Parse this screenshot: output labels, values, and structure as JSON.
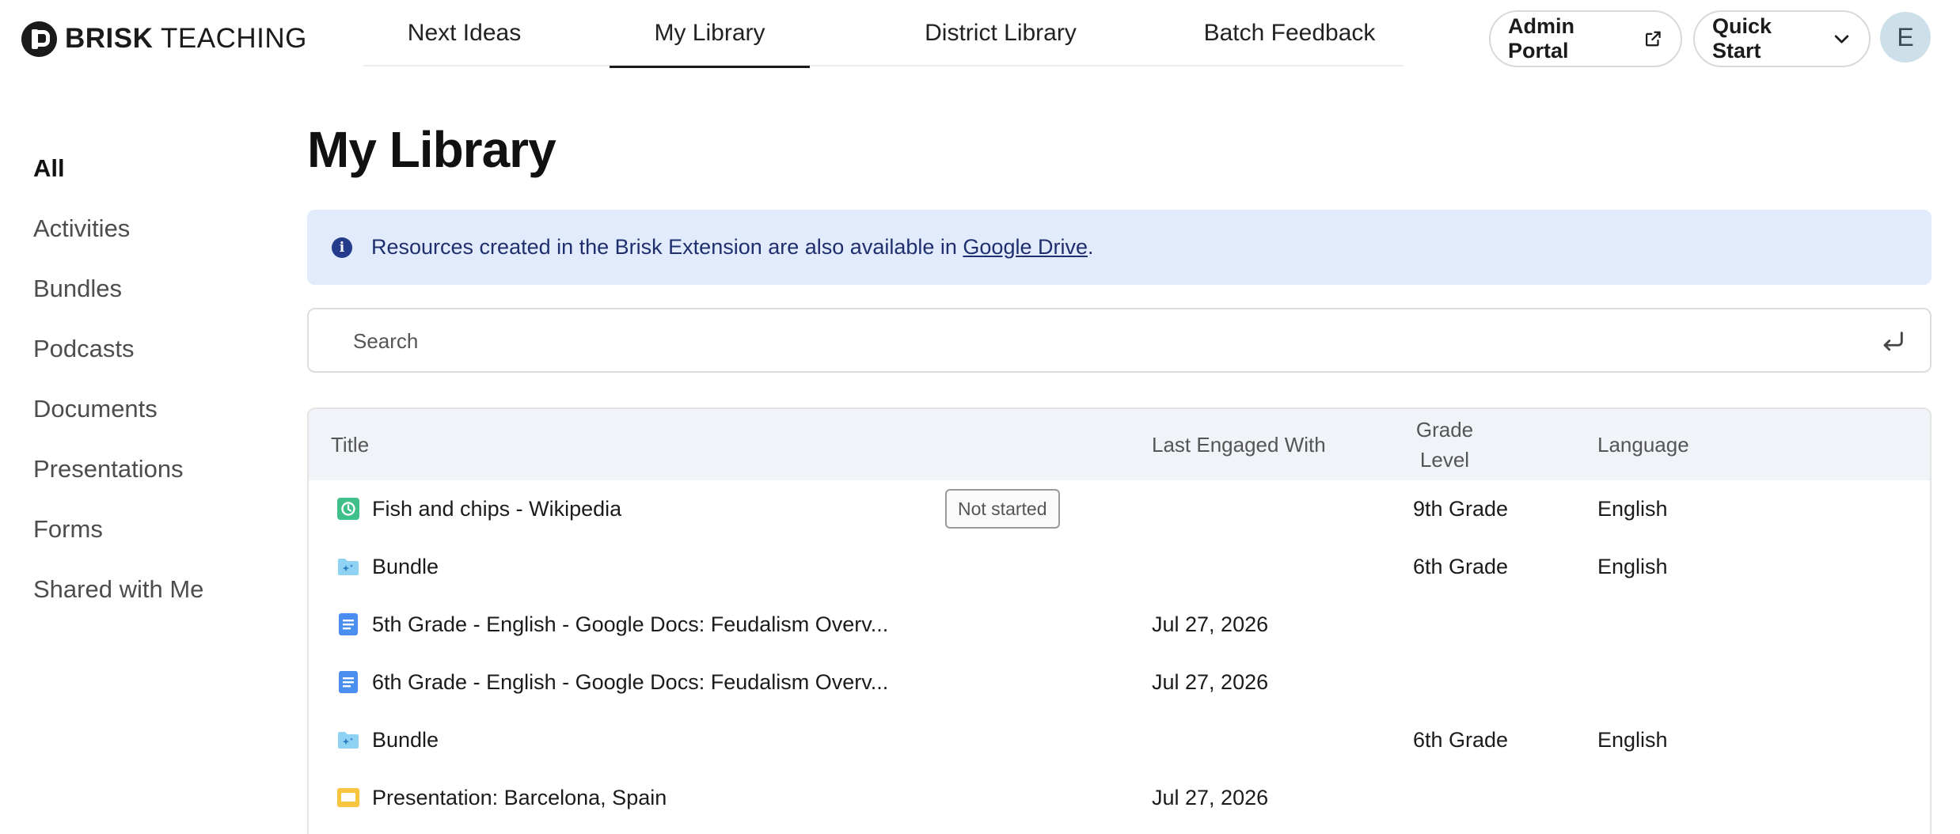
{
  "app": {
    "brand_bold": "BRISK",
    "brand_rest": " TEACHING"
  },
  "nav": {
    "tabs": [
      {
        "label": "Next Ideas"
      },
      {
        "label": "My Library"
      },
      {
        "label": "District Library"
      },
      {
        "label": "Batch Feedback"
      }
    ],
    "active_tab": "My Library"
  },
  "header": {
    "admin_portal_label": "Admin Portal",
    "quick_start_label": "Quick Start",
    "avatar_initial": "E"
  },
  "sidebar": {
    "items": [
      {
        "label": "All"
      },
      {
        "label": "Activities"
      },
      {
        "label": "Bundles"
      },
      {
        "label": "Podcasts"
      },
      {
        "label": "Documents"
      },
      {
        "label": "Presentations"
      },
      {
        "label": "Forms"
      },
      {
        "label": "Shared with Me"
      }
    ],
    "active_item": "All"
  },
  "main": {
    "title": "My Library",
    "banner": {
      "text_before": "Resources created in the Brisk Extension are also available in ",
      "link_text": "Google Drive",
      "text_after": "."
    },
    "search": {
      "placeholder": "Search",
      "value": ""
    },
    "table": {
      "columns": {
        "title": "Title",
        "last_engaged": "Last Engaged With",
        "grade_line1": "Grade",
        "grade_line2": "Level",
        "language": "Language"
      },
      "rows": [
        {
          "icon": "activity-icon",
          "title": "Fish and chips - Wikipedia",
          "status": "Not started",
          "last_engaged": "",
          "grade": "9th Grade",
          "language": "English"
        },
        {
          "icon": "bundle-folder-icon",
          "title": "Bundle",
          "status": "",
          "last_engaged": "",
          "grade": "6th Grade",
          "language": "English"
        },
        {
          "icon": "google-doc-icon",
          "title": "5th Grade - English - Google Docs: Feudalism Overv...",
          "status": "",
          "last_engaged": "Jul 27, 2026",
          "grade": "",
          "language": ""
        },
        {
          "icon": "google-doc-icon",
          "title": "6th Grade - English - Google Docs: Feudalism Overv...",
          "status": "",
          "last_engaged": "Jul 27, 2026",
          "grade": "",
          "language": ""
        },
        {
          "icon": "bundle-folder-icon",
          "title": "Bundle",
          "status": "",
          "last_engaged": "",
          "grade": "6th Grade",
          "language": "English"
        },
        {
          "icon": "google-slides-icon",
          "title": "Presentation: Barcelona, Spain",
          "status": "",
          "last_engaged": "Jul 27, 2026",
          "grade": "",
          "language": ""
        }
      ]
    }
  },
  "colors": {
    "banner_bg": "#e1ebfb",
    "banner_text": "#1f2f6e",
    "activity_green": "#3fbf8a",
    "bundle_blue": "#8fd3f4",
    "doc_blue": "#4a8ff0",
    "slides_yellow": "#f6c43d"
  }
}
